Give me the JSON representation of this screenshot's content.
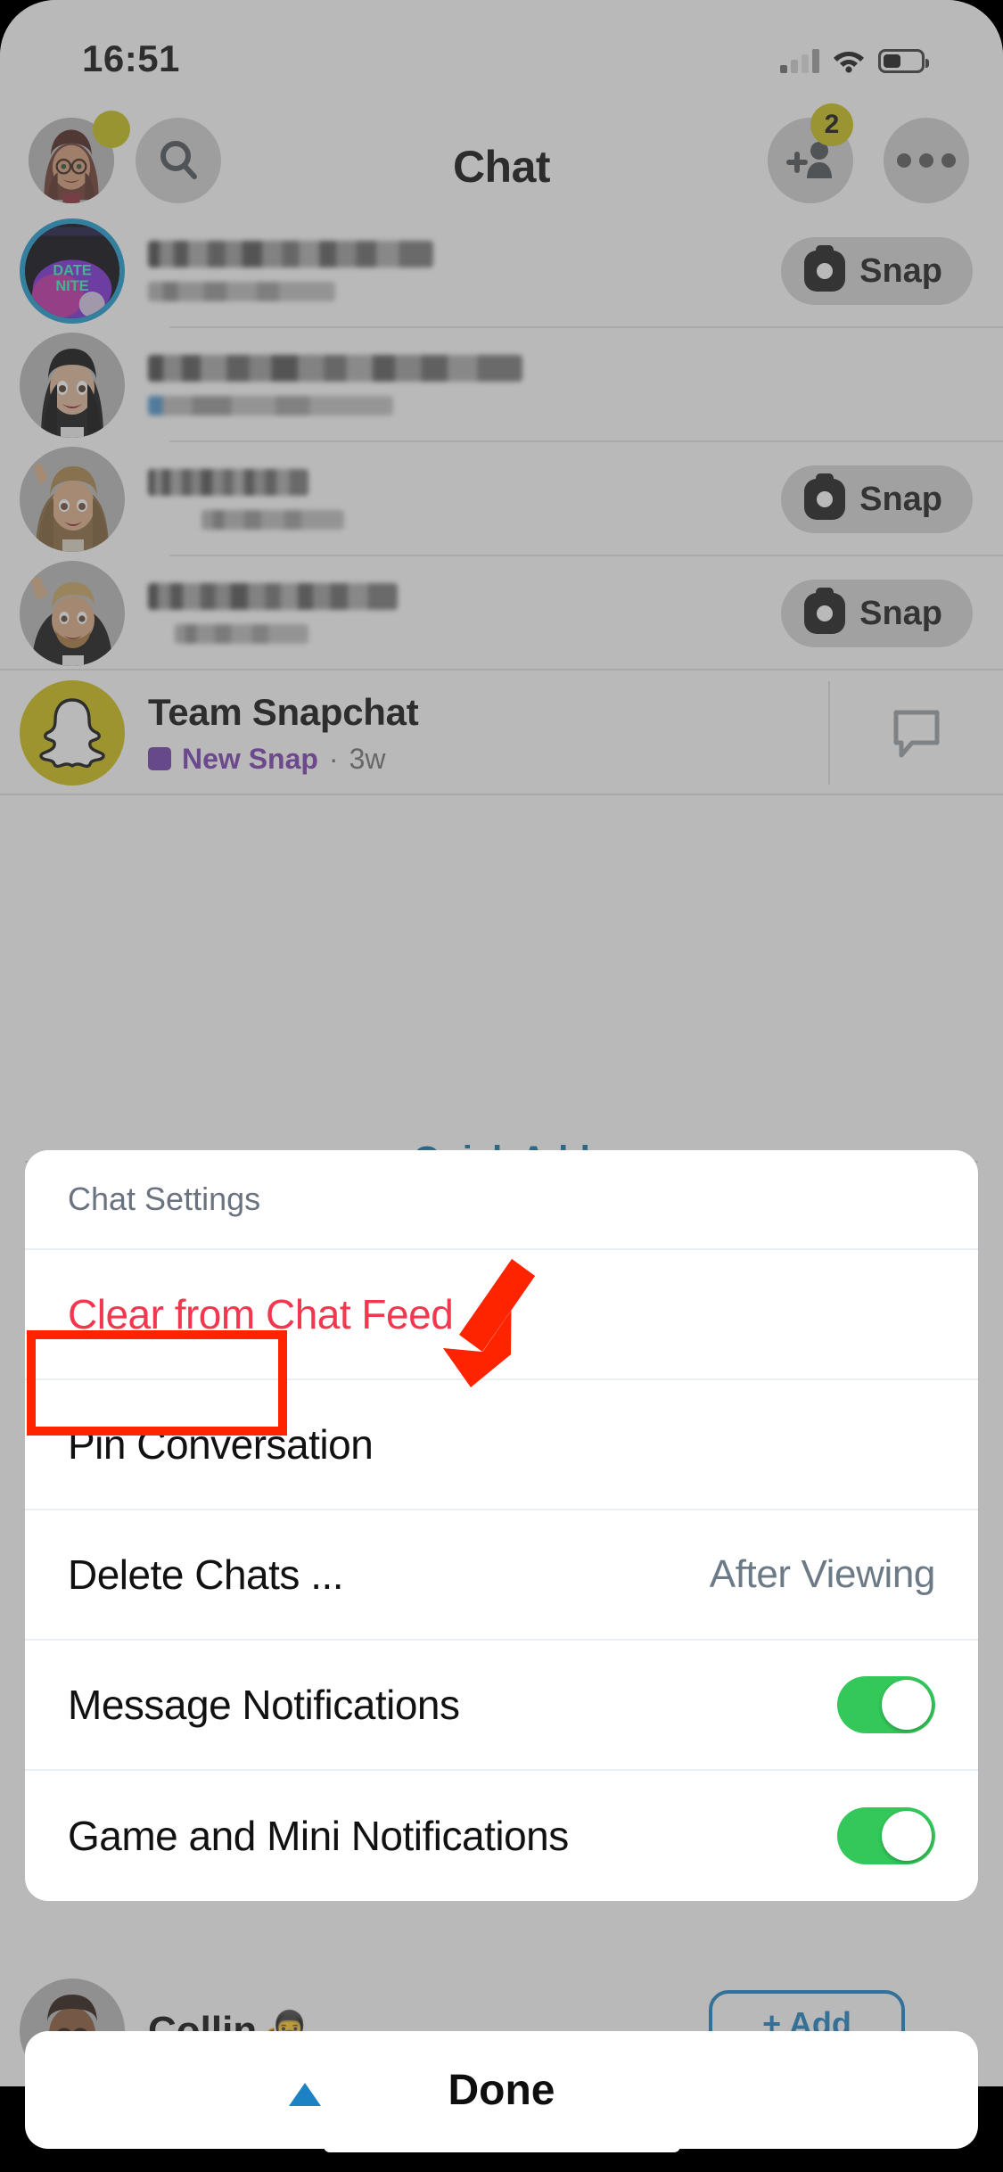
{
  "status_bar": {
    "time": "16:51",
    "icons": [
      "cellular-signal-icon",
      "wifi-icon",
      "battery-icon"
    ]
  },
  "header": {
    "title": "Chat",
    "avatar_icon": "bitmoji-avatar",
    "avatar_badge_icon": "yellow-story-badge",
    "search_icon": "search-icon",
    "add_friend_icon": "add-friend-icon",
    "add_friend_badge": "2",
    "more_icon": "more-options-icon"
  },
  "chat_rows": [
    {
      "avatar_icon": "date-nite-story-avatar",
      "avatar_ring": true,
      "name": "",
      "subtitle": "",
      "action_label": "Snap",
      "action_icon": "camera-icon",
      "blurred": true
    },
    {
      "avatar_icon": "bitmoji-dark-hair",
      "avatar_ring": false,
      "name": "",
      "subtitle": "",
      "action_label": "",
      "action_icon": "",
      "blurred": true
    },
    {
      "avatar_icon": "bitmoji-waving-blonde",
      "avatar_ring": false,
      "name": "",
      "subtitle": "",
      "action_label": "Snap",
      "action_icon": "camera-icon",
      "blurred": true
    },
    {
      "avatar_icon": "bitmoji-waving-man",
      "avatar_ring": false,
      "name": "",
      "subtitle": "",
      "action_label": "Snap",
      "action_icon": "camera-icon",
      "blurred": true
    }
  ],
  "team_snapchat": {
    "avatar_icon": "snapchat-ghost-icon",
    "name": "Team Snapchat",
    "status_label": "New Snap",
    "status_icon": "new-snap-square-icon",
    "separator": "·",
    "timestamp": "3w",
    "right_icon": "chat-bubble-icon"
  },
  "quick_add": {
    "label": "Quick Add"
  },
  "collin_row": {
    "avatar_icon": "bitmoji-collin",
    "name": "Collin",
    "name_emoji": "🥷",
    "add_label": "+ Add"
  },
  "sheet": {
    "title": "Chat Settings",
    "items": [
      {
        "label": "Clear from Chat Feed",
        "type": "danger",
        "value": ""
      },
      {
        "label": "Pin Conversation",
        "type": "plain",
        "value": ""
      },
      {
        "label": "Delete Chats ...",
        "type": "value",
        "value": "After Viewing"
      },
      {
        "label": "Message Notifications",
        "type": "toggle",
        "value": "on"
      },
      {
        "label": "Game and Mini Notifications",
        "type": "toggle",
        "value": "on"
      }
    ]
  },
  "done_bar": {
    "label": "Done"
  },
  "annotations": {
    "highlight_target": "Pin Conversation",
    "box_color": "#ff2400",
    "arrow_color": "#ff2400"
  },
  "colors": {
    "danger_red": "#f2374f",
    "toggle_green": "#34c759",
    "snapchat_yellow": "#cfc014",
    "link_blue": "#1272a8",
    "new_snap_purple": "#7b3fb3",
    "story_ring_blue": "#1d9bd1",
    "annotation_red": "#ff2400"
  }
}
